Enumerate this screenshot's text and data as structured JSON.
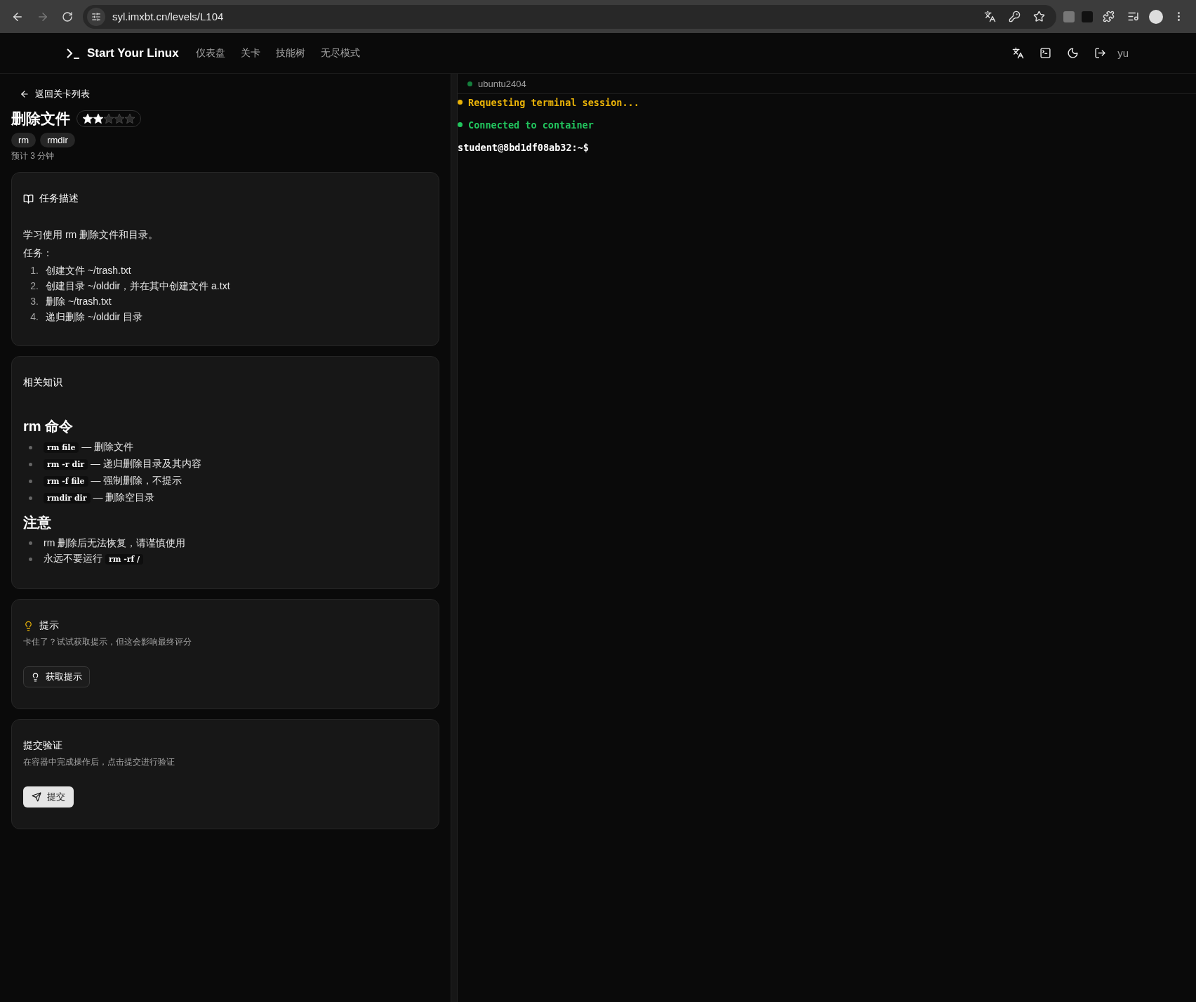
{
  "browser": {
    "url": "syl.imxbt.cn/levels/L104"
  },
  "nav": {
    "brand": "Start Your Linux",
    "links": [
      {
        "label": "仪表盘",
        "selected": false
      },
      {
        "label": "关卡",
        "selected": false
      },
      {
        "label": "技能树",
        "selected": false
      },
      {
        "label": "无尽模式",
        "selected": false
      }
    ],
    "user": "yu"
  },
  "level": {
    "back": "返回关卡列表",
    "title": "删除文件",
    "stars": 2,
    "tags": [
      "rm",
      "rmdir"
    ],
    "estimate": "预计 3 分钟"
  },
  "task": {
    "heading": "任务描述",
    "intro": "学习使用 rm 删除文件和目录。",
    "label": "任务：",
    "steps": [
      {
        "marker": "1.",
        "text": "创建文件 ~/trash.txt"
      },
      {
        "marker": "2.",
        "text": "创建目录 ~/olddir，并在其中创建文件 a.txt"
      },
      {
        "marker": "3.",
        "text": "删除 ~/trash.txt"
      },
      {
        "marker": "4.",
        "text": "递归删除 ~/olddir 目录"
      }
    ]
  },
  "knowledge": {
    "heading": "相关知识",
    "sections": [
      {
        "title": "rm 命令",
        "items": [
          [
            {
              "kind": "code",
              "text": "rm file"
            },
            {
              "kind": "text",
              "text": " — 删除文件"
            }
          ],
          [
            {
              "kind": "code",
              "text": "rm -r dir"
            },
            {
              "kind": "text",
              "text": " — 递归删除目录及其内容"
            }
          ],
          [
            {
              "kind": "code",
              "text": "rm -f file"
            },
            {
              "kind": "text",
              "text": " — 强制删除，不提示"
            }
          ],
          [
            {
              "kind": "code",
              "text": "rmdir dir"
            },
            {
              "kind": "text",
              "text": " — 删除空目录"
            }
          ]
        ]
      },
      {
        "title": "注意",
        "items": [
          [
            {
              "kind": "text",
              "text": "rm 删除后无法恢复，请谨慎使用"
            }
          ],
          [
            {
              "kind": "text",
              "text": "永远不要运行 "
            },
            {
              "kind": "code",
              "text": "rm -rf /"
            }
          ]
        ]
      }
    ]
  },
  "hint": {
    "heading": "提示",
    "description": "卡住了？试试获取提示，但这会影响最终评分",
    "button": "获取提示"
  },
  "submit": {
    "heading": "提交验证",
    "description": "在容器中完成操作后，点击提交进行验证",
    "button": "提交"
  },
  "terminal": {
    "container": "ubuntu2404",
    "lines": [
      {
        "kind": "status",
        "text": "Requesting terminal session...",
        "color": "#eab308"
      },
      {
        "kind": "status",
        "text": "Connected to container",
        "color": "#22c55e"
      },
      {
        "kind": "prompt",
        "text": "student@8bd1df08ab32:~$"
      }
    ]
  }
}
